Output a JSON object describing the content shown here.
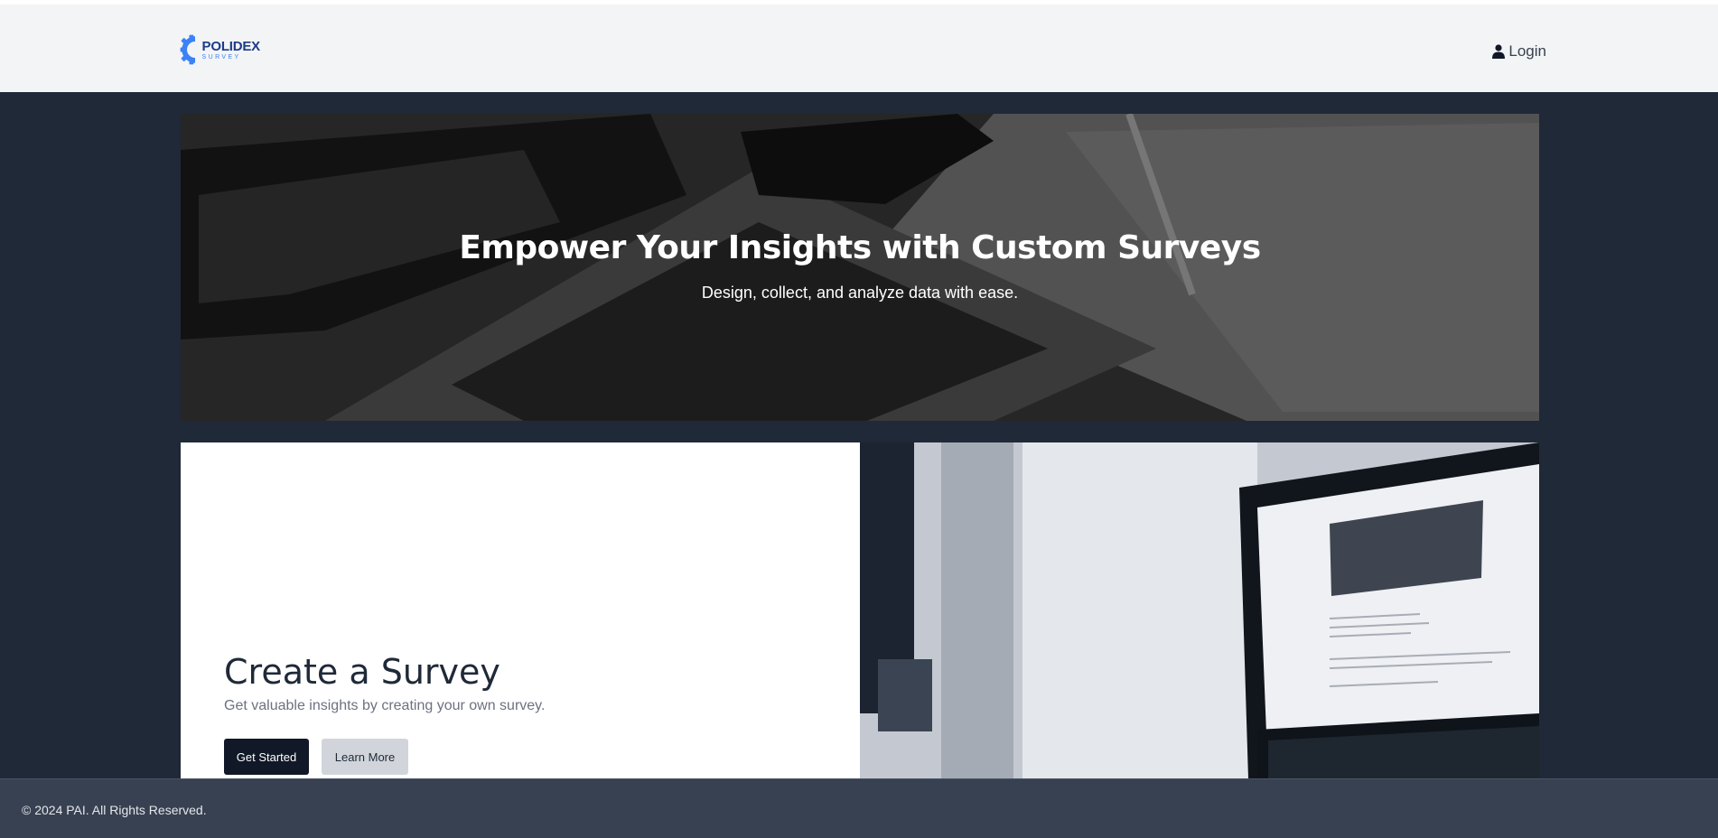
{
  "header": {
    "logo": {
      "brand": "POLIDEX",
      "sub": "SURVEY"
    },
    "login_label": "Login"
  },
  "hero": {
    "title": "Empower Your Insights with Custom Surveys",
    "subtitle": "Design, collect, and analyze data with ease."
  },
  "feature": {
    "title": "Create a Survey",
    "description": "Get valuable insights by creating your own survey.",
    "primary_button": "Get Started",
    "secondary_button": "Learn More"
  },
  "footer": {
    "copyright": "© 2024 PAI. All Rights Reserved."
  },
  "colors": {
    "header_bg": "#f3f4f6",
    "page_bg": "#1f2937",
    "footer_bg": "#374151",
    "primary_button": "#111827",
    "secondary_button": "#d1d5db",
    "logo_blue": "#3b82f6",
    "logo_navy": "#1e3a8a"
  },
  "icons": {
    "login": "user-icon",
    "logo": "gear-icon"
  }
}
